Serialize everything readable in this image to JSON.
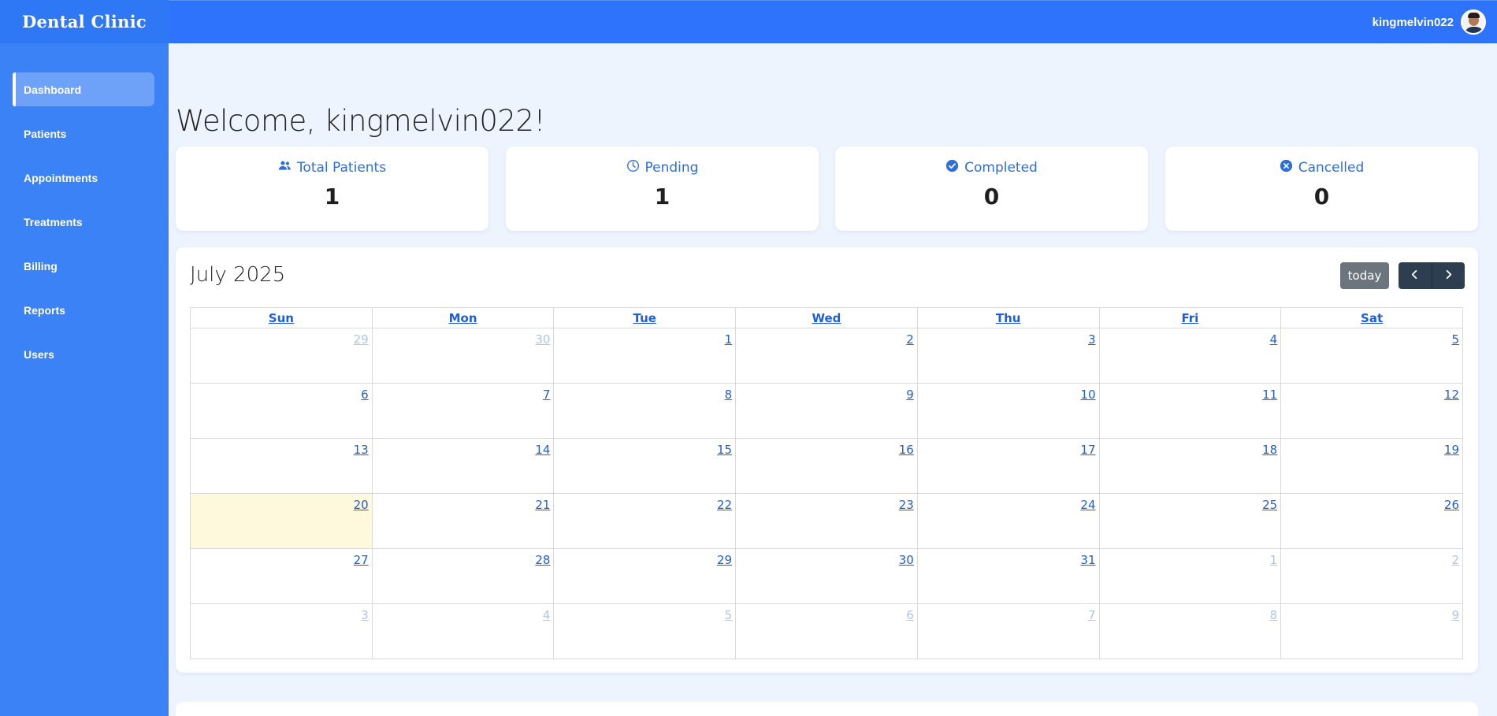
{
  "sidebar": {
    "brand": "Dental Clinic",
    "items": [
      {
        "label": "Dashboard"
      },
      {
        "label": "Patients"
      },
      {
        "label": "Appointments"
      },
      {
        "label": "Treatments"
      },
      {
        "label": "Billing"
      },
      {
        "label": "Reports"
      },
      {
        "label": "Users"
      }
    ]
  },
  "header": {
    "username": "kingmelvin022"
  },
  "welcome": "Welcome, kingmelvin022!",
  "stats": [
    {
      "label": "Total Patients",
      "value": "1",
      "icon": "users-icon"
    },
    {
      "label": "Pending",
      "value": "1",
      "icon": "clock-icon"
    },
    {
      "label": "Completed",
      "value": "0",
      "icon": "check-circle-icon"
    },
    {
      "label": "Cancelled",
      "value": "0",
      "icon": "x-circle-icon"
    }
  ],
  "calendar": {
    "title": "July 2025",
    "today_label": "today",
    "weekdays": [
      "Sun",
      "Mon",
      "Tue",
      "Wed",
      "Thu",
      "Fri",
      "Sat"
    ],
    "weeks": [
      [
        "29",
        "30",
        "1",
        "2",
        "3",
        "4",
        "5"
      ],
      [
        "6",
        "7",
        "8",
        "9",
        "10",
        "11",
        "12"
      ],
      [
        "13",
        "14",
        "15",
        "16",
        "17",
        "18",
        "19"
      ],
      [
        "20",
        "21",
        "22",
        "23",
        "24",
        "25",
        "26"
      ],
      [
        "27",
        "28",
        "29",
        "30",
        "31",
        "1",
        "2"
      ],
      [
        "3",
        "4",
        "5",
        "6",
        "7",
        "8",
        "9"
      ]
    ]
  },
  "colors": {
    "sidebar": "#3b82f6",
    "topbar": "#2d73fb",
    "accent": "#2f6fd8",
    "today_highlight": "#fef8dd",
    "nav_button": "#2c3e50",
    "today_button": "#6c757d"
  }
}
